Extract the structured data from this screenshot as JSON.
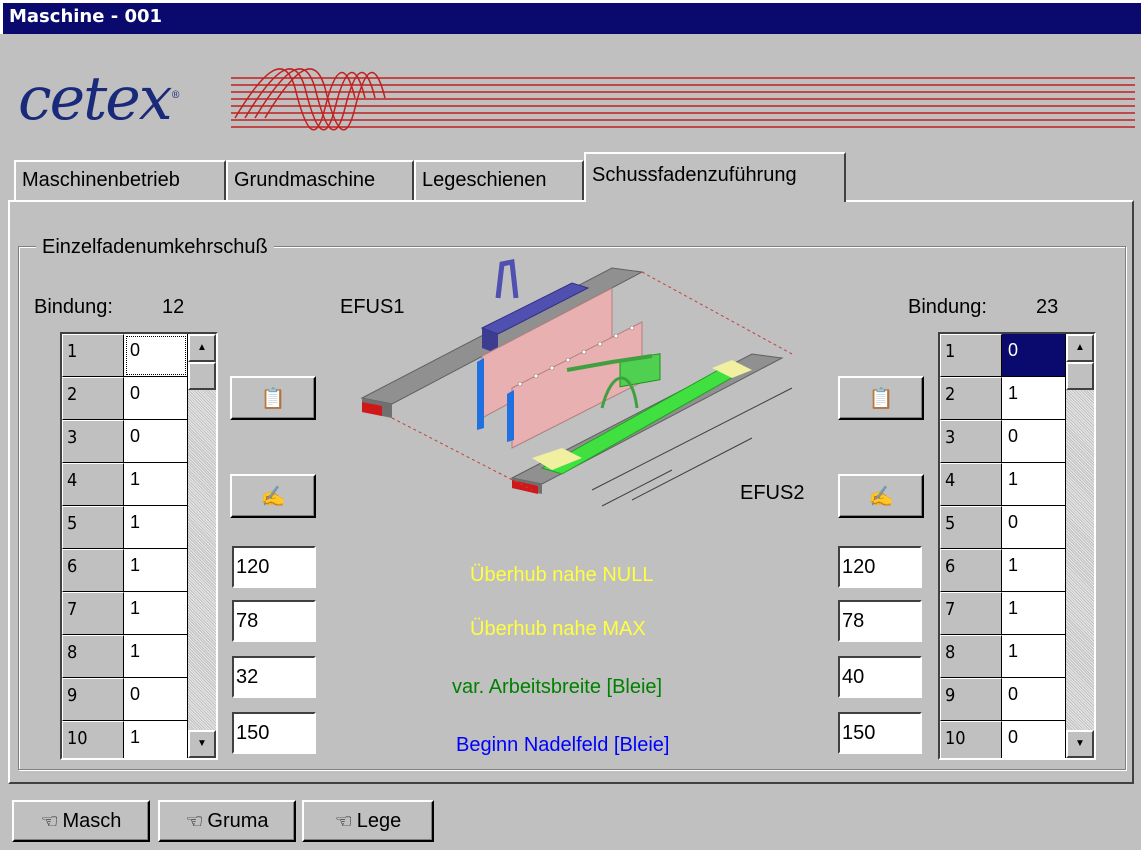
{
  "window": {
    "title": "Maschine - 001"
  },
  "logo": {
    "text": "cetex",
    "reg_mark": "®"
  },
  "tabs": [
    {
      "label": "Maschinenbetrieb",
      "active": false
    },
    {
      "label": "Grundmaschine",
      "active": false
    },
    {
      "label": "Legeschienen",
      "active": false
    },
    {
      "label": "Schussfadenzuführung",
      "active": true
    }
  ],
  "group": {
    "title": "Einzelfadenumkehrschuß"
  },
  "left": {
    "bindung_label": "Bindung:",
    "bindung_value": "12",
    "efus_label": "EFUS1",
    "rows": [
      {
        "n": "1",
        "v": "0"
      },
      {
        "n": "2",
        "v": "0"
      },
      {
        "n": "3",
        "v": "0"
      },
      {
        "n": "4",
        "v": "1"
      },
      {
        "n": "5",
        "v": "1"
      },
      {
        "n": "6",
        "v": "1"
      },
      {
        "n": "7",
        "v": "1"
      },
      {
        "n": "8",
        "v": "1"
      },
      {
        "n": "9",
        "v": "0"
      },
      {
        "n": "10",
        "v": "1"
      }
    ],
    "inputs": [
      "120",
      "78",
      "32",
      "150"
    ]
  },
  "right": {
    "bindung_label": "Bindung:",
    "bindung_value": "23",
    "efus_label": "EFUS2",
    "rows": [
      {
        "n": "1",
        "v": "0"
      },
      {
        "n": "2",
        "v": "1"
      },
      {
        "n": "3",
        "v": "0"
      },
      {
        "n": "4",
        "v": "1"
      },
      {
        "n": "5",
        "v": "0"
      },
      {
        "n": "6",
        "v": "1"
      },
      {
        "n": "7",
        "v": "1"
      },
      {
        "n": "8",
        "v": "1"
      },
      {
        "n": "9",
        "v": "0"
      },
      {
        "n": "10",
        "v": "0"
      }
    ],
    "inputs": [
      "120",
      "78",
      "40",
      "150"
    ]
  },
  "descriptions": [
    {
      "text": "Überhub nahe NULL",
      "color": "#ffff40"
    },
    {
      "text": "Überhub nahe MAX",
      "color": "#ffff40"
    },
    {
      "text": "var. Arbeitsbreite [Bleie]",
      "color": "#008000"
    },
    {
      "text": "Beginn Nadelfeld [Bleie]",
      "color": "#0000ff"
    }
  ],
  "nav_buttons": [
    {
      "label": "Masch",
      "icon": "hand-pointer-icon"
    },
    {
      "label": "Gruma",
      "icon": "hand-pointer-icon"
    },
    {
      "label": "Lege",
      "icon": "hand-pointer-icon"
    }
  ],
  "icons": {
    "copy": "document-copy-icon",
    "paste": "hand-paste-icon"
  }
}
